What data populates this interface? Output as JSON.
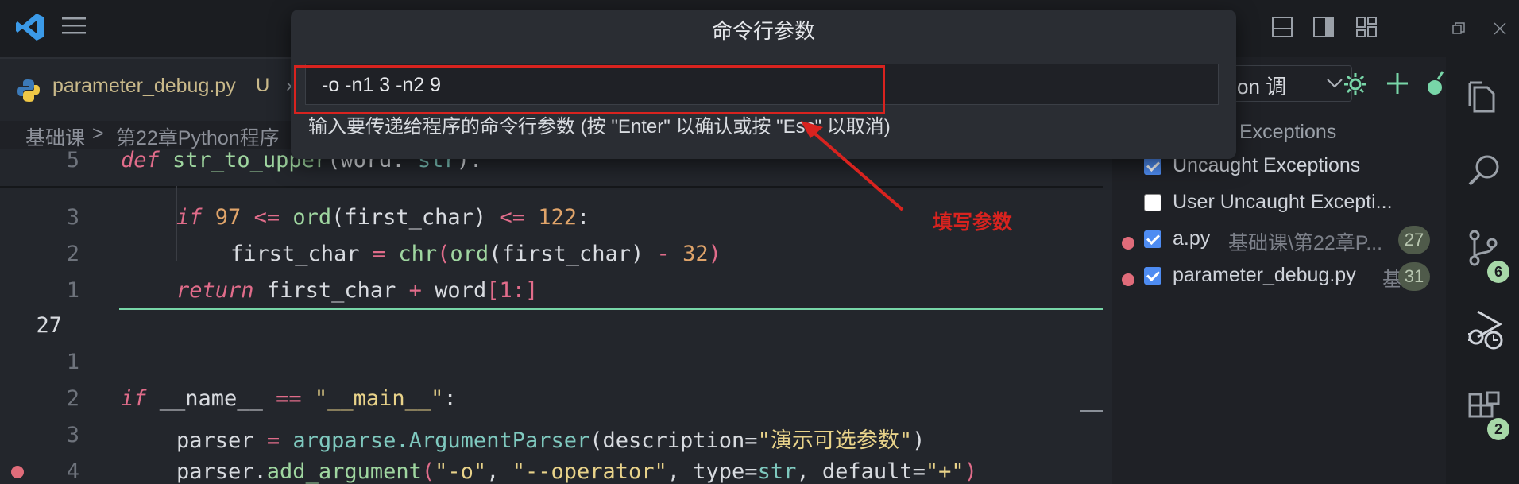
{
  "palette": {
    "title": "命令行参数",
    "input_value": "-o -n1 3 -n2 9",
    "hint": "输入要传递给程序的命令行参数 (按 \"Enter\" 以确认或按 \"Esc\" 以取消)"
  },
  "annotation": {
    "label": "填写参数",
    "color": "#d8231f"
  },
  "tab": {
    "filename": "parameter_debug.py",
    "status": "U"
  },
  "breadcrumb": {
    "root": "基础课",
    "sep": ">",
    "chapter": "第22章Python程序"
  },
  "run_config": {
    "label": "on 调"
  },
  "editor": {
    "lines": [
      {
        "num": "5"
      },
      {
        "num": "3"
      },
      {
        "num": "2"
      },
      {
        "num": "1"
      },
      {
        "num": "27"
      },
      {
        "num": "1"
      },
      {
        "num": "2"
      },
      {
        "num": "3"
      },
      {
        "num": "4"
      }
    ],
    "code": {
      "l5_kw": "def",
      "l5_fn": "str_to_upper",
      "l5_param": "(word: ",
      "l5_type": "str",
      "l5_end": "):",
      "l3_kw": "if",
      "l3_num1": "97",
      "l3_op1": "<=",
      "l3_fn": "ord",
      "l3_arg": "(first_char)",
      "l3_op2": "<=",
      "l3_num2": "122",
      "l3_end": ":",
      "l2_var": "first_char",
      "l2_eq": "=",
      "l2_fn1": "chr",
      "l2_p1": "(",
      "l2_fn2": "ord",
      "l2_arg": "(first_char)",
      "l2_minus": "-",
      "l2_num": "32",
      "l2_end": ")",
      "l1_kw": "return",
      "l1_a": "first_char",
      "l1_plus": "+",
      "l1_b": "word",
      "l1_idx": "[1:]",
      "m2_kw": "if",
      "m2_name": "__name__",
      "m2_eq": "==",
      "m2_str": "\"__main__\"",
      "m2_end": ":",
      "m3_var": "parser",
      "m3_eq": "=",
      "m3_mod": "argparse.",
      "m3_cls": "ArgumentParser",
      "m3_kw": "(description=",
      "m3_str": "\"演示可选参数\"",
      "m3_end": ")",
      "m4_var": "parser.",
      "m4_fn": "add_argument",
      "m4_p": "(",
      "m4_s1": "\"-o\"",
      "m4_c1": ", ",
      "m4_s2": "\"--operator\"",
      "m4_c2": ", type=",
      "m4_ty": "str",
      "m4_c3": ", default=",
      "m4_s3": "\"+\"",
      "m4_end": ")"
    }
  },
  "breakpoints_panel": {
    "header_partial": "Exceptions",
    "items": [
      {
        "label": "Uncaught Exceptions",
        "checked": true
      },
      {
        "label": "User Uncaught Excepti...",
        "checked": false
      },
      {
        "label": "a.py",
        "path": "基础课\\第22章P...",
        "count": "27",
        "checked": true
      },
      {
        "label": "parameter_debug.py",
        "path": "基",
        "count": "31",
        "checked": true
      }
    ]
  },
  "activity_badges": {
    "source_control": "6",
    "extensions": "2"
  },
  "colors": {
    "accent_green": "#78d6a8",
    "breakpoint": "#e06c7a",
    "checkbox": "#4e8cf2"
  }
}
